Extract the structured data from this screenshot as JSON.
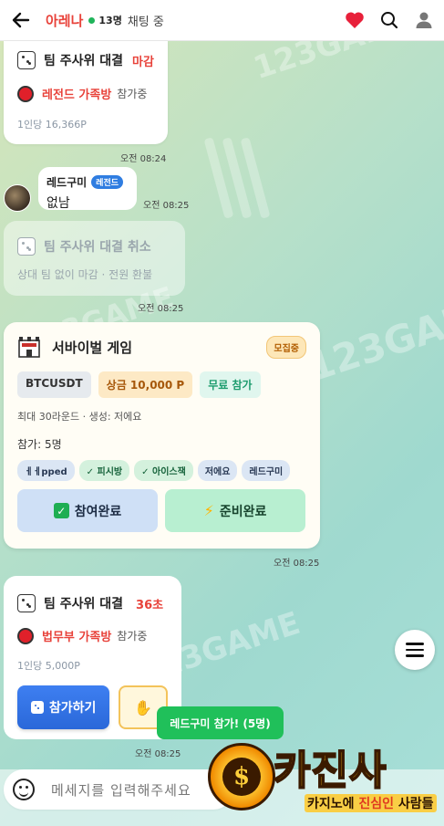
{
  "header": {
    "room_name": "아레나",
    "member_count": "13명",
    "chat_status": "채팅 중",
    "icons": [
      "back-arrow-icon",
      "heart-icon",
      "search-icon",
      "user-icon"
    ],
    "accent_color": "#e8423a"
  },
  "watermark": "123GAME",
  "messages": {
    "dice_closed": {
      "title": "팀 주사위 대결",
      "status": "마감",
      "team_name": "레전드 가족방",
      "team_status": "참가중",
      "per_person": "1인당 16,366P",
      "time": "오전 08:24"
    },
    "chat": {
      "sender": "레드구미",
      "badge": "레전드",
      "text": "없남",
      "time": "오전 08:25"
    },
    "dice_cancelled": {
      "title": "팀 주사위 대결 취소",
      "sub": "상대 팀 없이 마감 · 전원 환불",
      "time": "오전 08:25"
    },
    "survival_game": {
      "title": "서바이벌 게임",
      "badge": "모집중",
      "symbol": "BTCUSDT",
      "prize": "상금 10,000 P",
      "entry": "무료 참가",
      "meta": "최대 30라운드 · 생성: 저에요",
      "participants_label": "참가: 5명",
      "participants": [
        {
          "name": "ㅔㅔpped",
          "checked": false
        },
        {
          "name": "✓ 피시방",
          "checked": true
        },
        {
          "name": "✓ 아이스잭",
          "checked": true
        },
        {
          "name": "저에요",
          "checked": false
        },
        {
          "name": "레드구미",
          "checked": false
        }
      ],
      "join_done": "참여완료",
      "ready_done": "준비완료",
      "time": "오전 08:25"
    },
    "dice_open": {
      "title": "팀 주사위 대결",
      "timer": "36초",
      "team_name": "법무부 가족방",
      "team_status": "참가중",
      "per_person": "1인당 5,000P",
      "join_button": "참가하기",
      "time": "오전 08:25"
    }
  },
  "toast": "레드구미 참가! (5명)",
  "input": {
    "placeholder": "메세지를 입력해주세요"
  },
  "logo": {
    "text": "카진사",
    "sub_before": "카지노에 ",
    "sub_highlight": "진심인",
    "sub_after": " 사람들"
  }
}
